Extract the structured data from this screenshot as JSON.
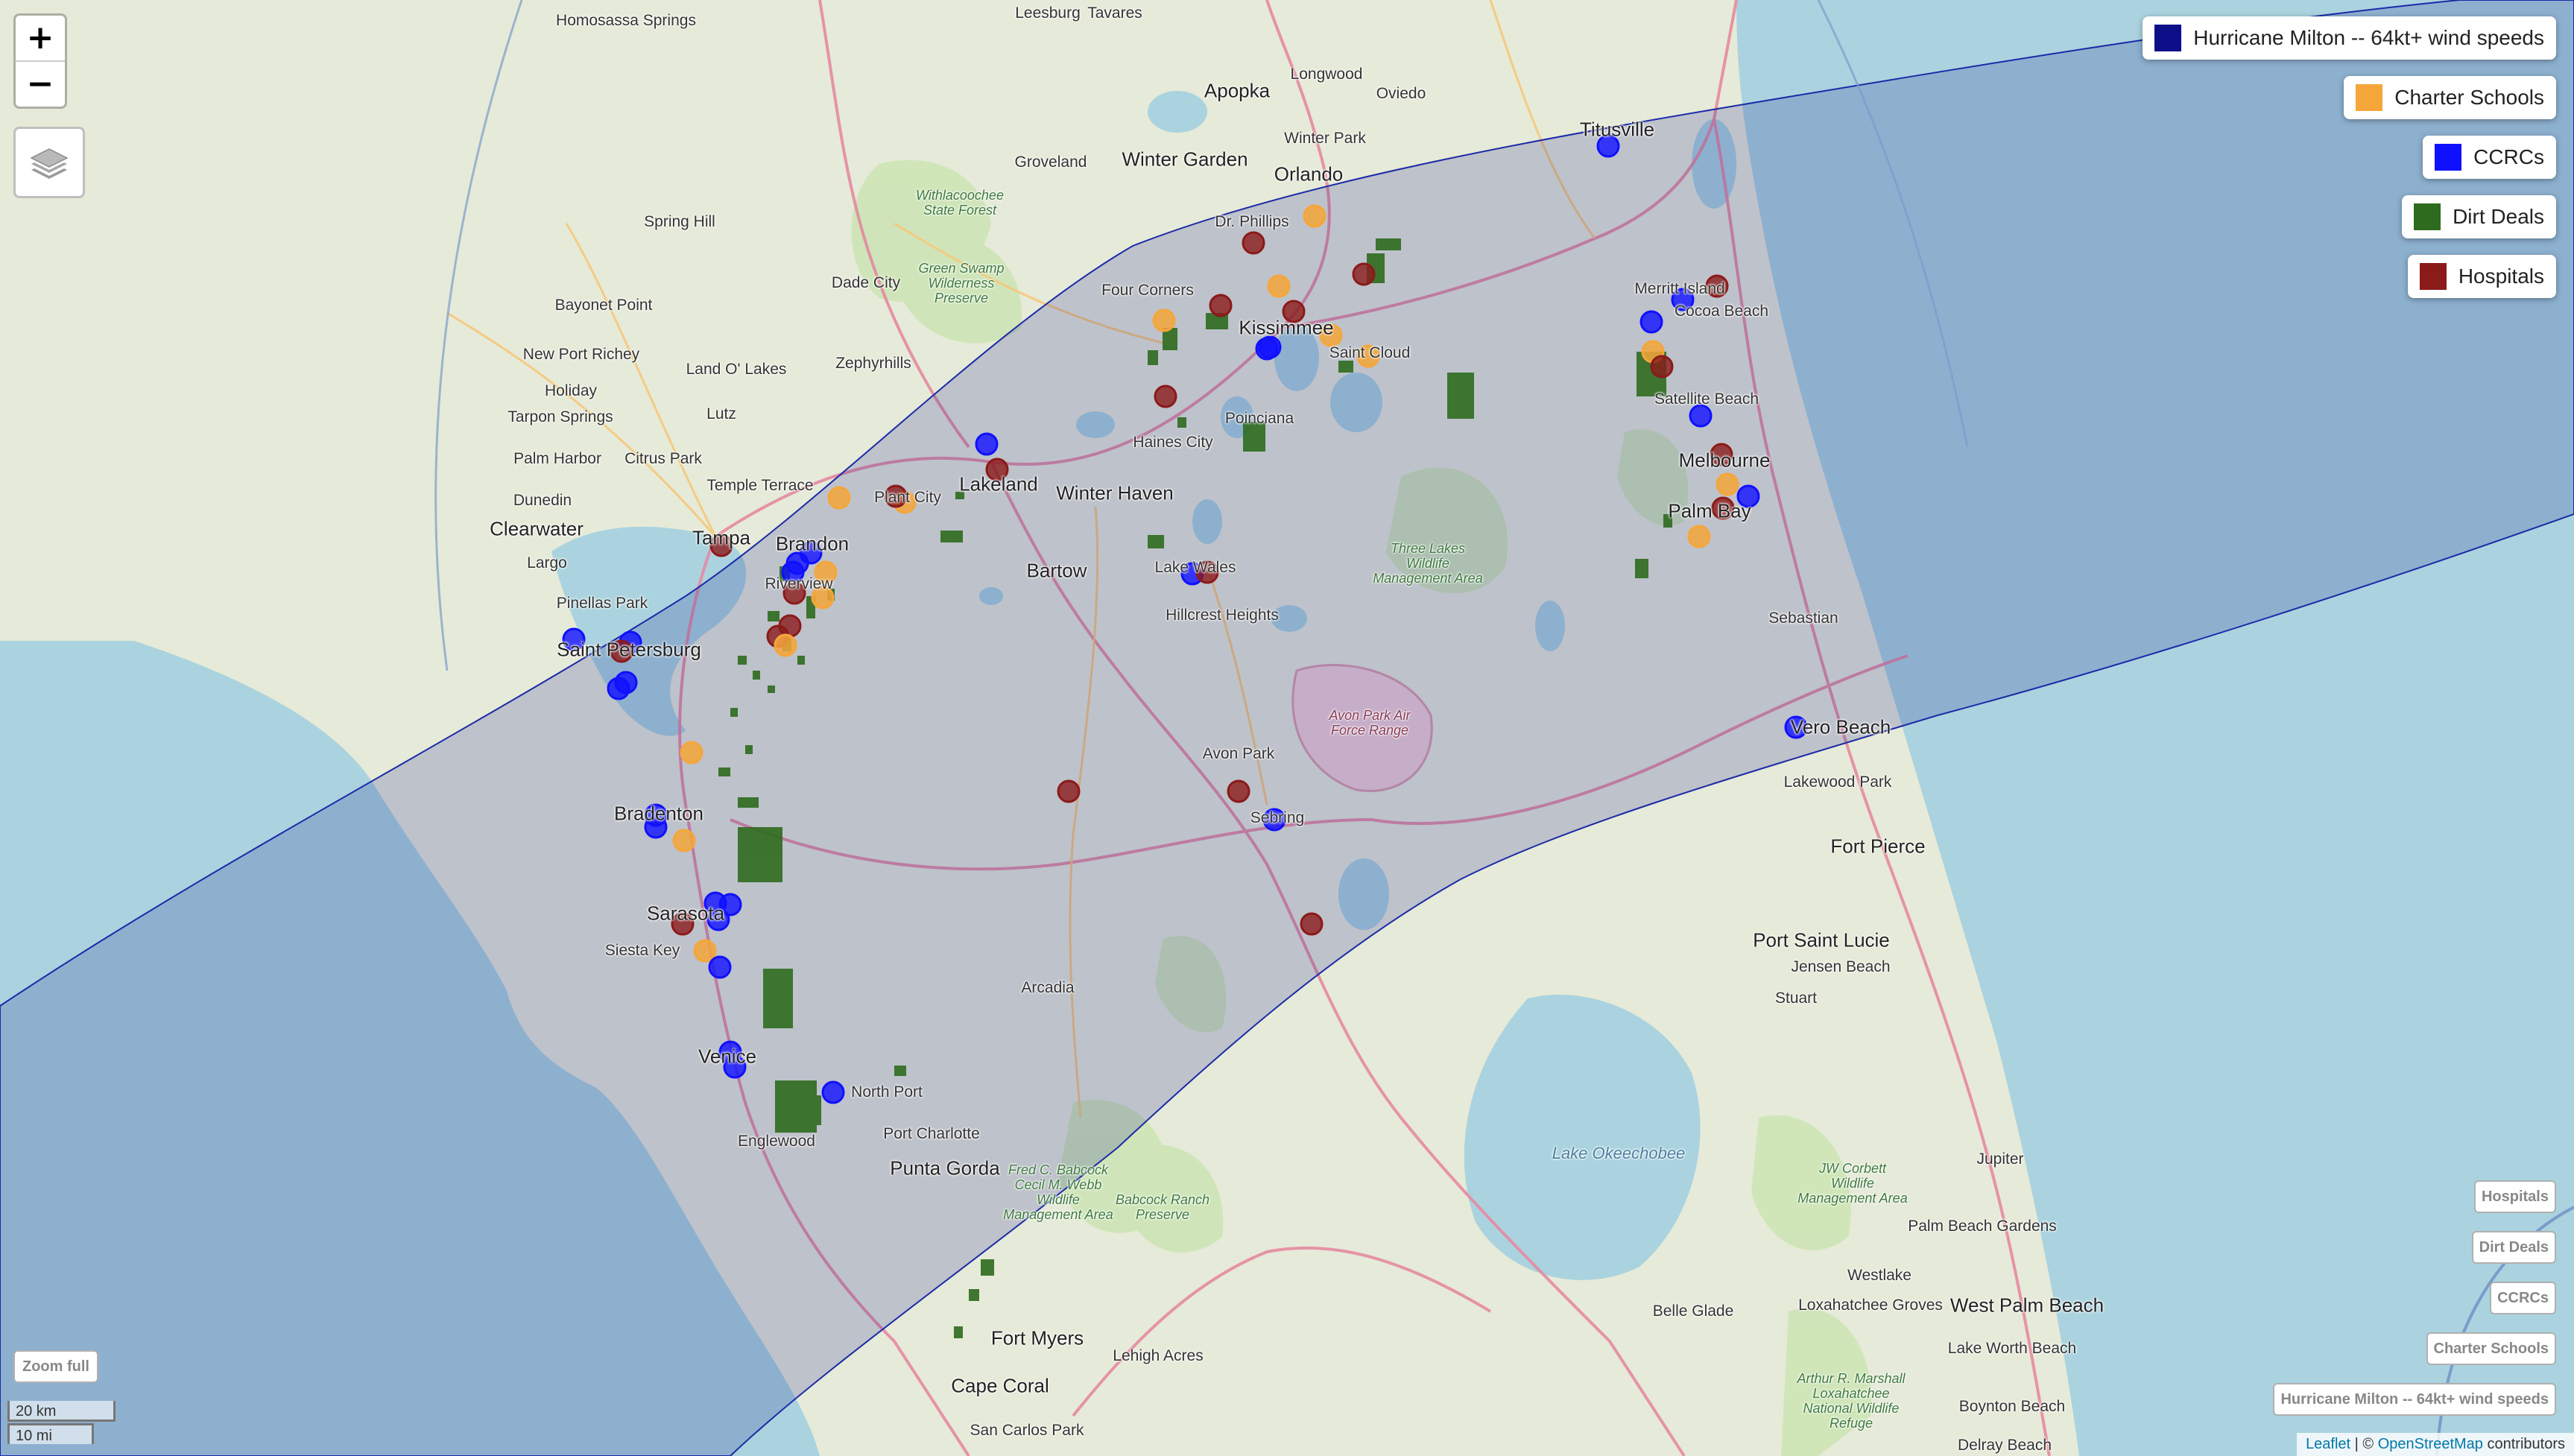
{
  "map": {
    "zoom_in_label": "+",
    "zoom_out_label": "−",
    "layers_icon": "layers-icon",
    "zoom_full_label": "Zoom full",
    "scale_km": "20 km",
    "scale_mi": "10 mi",
    "attribution": {
      "leaflet": "Leaflet",
      "separator": " | © ",
      "osm": "OpenStreetMap",
      "suffix": " contributors"
    }
  },
  "legend": [
    {
      "label": "Hurricane Milton -- 64kt+ wind speeds",
      "color": "#0d0f8a"
    },
    {
      "label": "Charter Schools",
      "color": "#f5a63a"
    },
    {
      "label": "CCRCs",
      "color": "#1010ff"
    },
    {
      "label": "Dirt Deals",
      "color": "#2e6b1f"
    },
    {
      "label": "Hospitals",
      "color": "#8b1a1a"
    }
  ],
  "layer_toggles": [
    "Hospitals",
    "Dirt Deals",
    "CCRCs",
    "Charter Schools",
    "Hurricane Milton -- 64kt+ wind speeds"
  ],
  "place_labels": [
    {
      "text": "Homosassa Springs",
      "cls": "city"
    },
    {
      "text": "Leesburg",
      "cls": "city"
    },
    {
      "text": "Tavares",
      "cls": "city"
    },
    {
      "text": "Apopka",
      "cls": "big"
    },
    {
      "text": "Longwood",
      "cls": "city"
    },
    {
      "text": "Oviedo",
      "cls": "city"
    },
    {
      "text": "Titusville",
      "cls": "big"
    },
    {
      "text": "Groveland",
      "cls": "city"
    },
    {
      "text": "Winter Garden",
      "cls": "big"
    },
    {
      "text": "Winter Park",
      "cls": "city"
    },
    {
      "text": "Orlando",
      "cls": "big"
    },
    {
      "text": "Spring Hill",
      "cls": "city"
    },
    {
      "text": "Dr. Phillips",
      "cls": "city"
    },
    {
      "text": "Dade City",
      "cls": "city"
    },
    {
      "text": "Four Corners",
      "cls": "city"
    },
    {
      "text": "Kissimmee",
      "cls": "big"
    },
    {
      "text": "Merritt Island",
      "cls": "city"
    },
    {
      "text": "Cocoa Beach",
      "cls": "city"
    },
    {
      "text": "Bayonet Point",
      "cls": "city"
    },
    {
      "text": "Zephyrhills",
      "cls": "city"
    },
    {
      "text": "New Port Richey",
      "cls": "city"
    },
    {
      "text": "Holiday",
      "cls": "city"
    },
    {
      "text": "Land O' Lakes",
      "cls": "city"
    },
    {
      "text": "Saint Cloud",
      "cls": "city"
    },
    {
      "text": "Satellite Beach",
      "cls": "city"
    },
    {
      "text": "Tarpon Springs",
      "cls": "city"
    },
    {
      "text": "Lutz",
      "cls": "city"
    },
    {
      "text": "Poinciana",
      "cls": "city"
    },
    {
      "text": "Palm Harbor",
      "cls": "city"
    },
    {
      "text": "Citrus Park",
      "cls": "city"
    },
    {
      "text": "Haines City",
      "cls": "city"
    },
    {
      "text": "Melbourne",
      "cls": "big"
    },
    {
      "text": "Dunedin",
      "cls": "city"
    },
    {
      "text": "Temple Terrace",
      "cls": "city"
    },
    {
      "text": "Plant City",
      "cls": "city"
    },
    {
      "text": "Lakeland",
      "cls": "big"
    },
    {
      "text": "Winter Haven",
      "cls": "big"
    },
    {
      "text": "Palm Bay",
      "cls": "big"
    },
    {
      "text": "Clearwater",
      "cls": "big"
    },
    {
      "text": "Tampa",
      "cls": "big"
    },
    {
      "text": "Brandon",
      "cls": "big"
    },
    {
      "text": "Largo",
      "cls": "city"
    },
    {
      "text": "Riverview",
      "cls": "city"
    },
    {
      "text": "Bartow",
      "cls": "big"
    },
    {
      "text": "Lake Wales",
      "cls": "city"
    },
    {
      "text": "Pinellas Park",
      "cls": "city"
    },
    {
      "text": "Sebastian",
      "cls": "city"
    },
    {
      "text": "Saint Petersburg",
      "cls": "big"
    },
    {
      "text": "Hillcrest Heights",
      "cls": "city"
    },
    {
      "text": "Vero Beach",
      "cls": "big"
    },
    {
      "text": "Lakewood Park",
      "cls": "city"
    },
    {
      "text": "Avon Park",
      "cls": "city"
    },
    {
      "text": "Sebring",
      "cls": "city"
    },
    {
      "text": "Fort Pierce",
      "cls": "big"
    },
    {
      "text": "Bradenton",
      "cls": "big"
    },
    {
      "text": "Sarasota",
      "cls": "big"
    },
    {
      "text": "Siesta Key",
      "cls": "city"
    },
    {
      "text": "Port Saint Lucie",
      "cls": "big"
    },
    {
      "text": "Jensen Beach",
      "cls": "city"
    },
    {
      "text": "Stuart",
      "cls": "city"
    },
    {
      "text": "Arcadia",
      "cls": "city"
    },
    {
      "text": "Venice",
      "cls": "big"
    },
    {
      "text": "North Port",
      "cls": "city"
    },
    {
      "text": "Port Charlotte",
      "cls": "city"
    },
    {
      "text": "Englewood",
      "cls": "city"
    },
    {
      "text": "Punta Gorda",
      "cls": "big"
    },
    {
      "text": "Jupiter",
      "cls": "city"
    },
    {
      "text": "Palm Beach Gardens",
      "cls": "city"
    },
    {
      "text": "Westlake",
      "cls": "city"
    },
    {
      "text": "Loxahatchee Groves",
      "cls": "city"
    },
    {
      "text": "West Palm Beach",
      "cls": "big"
    },
    {
      "text": "Belle Glade",
      "cls": "city"
    },
    {
      "text": "Fort Myers",
      "cls": "big"
    },
    {
      "text": "Lehigh Acres",
      "cls": "city"
    },
    {
      "text": "Cape Coral",
      "cls": "big"
    },
    {
      "text": "Lake Worth Beach",
      "cls": "city"
    },
    {
      "text": "Boynton Beach",
      "cls": "city"
    },
    {
      "text": "San Carlos Park",
      "cls": "city"
    },
    {
      "text": "Delray Beach",
      "cls": "city"
    },
    {
      "text": "Withlacoochee State Forest",
      "cls": "park"
    },
    {
      "text": "Green Swamp Wilderness Preserve",
      "cls": "park"
    },
    {
      "text": "Three Lakes Wildlife Management Area",
      "cls": "park"
    },
    {
      "text": "Avon Park Air Force Range",
      "cls": "airforce"
    },
    {
      "text": "Fred C. Babcock Cecil M. Webb Wildlife Management Area",
      "cls": "park"
    },
    {
      "text": "Babcock Ranch Preserve",
      "cls": "park"
    },
    {
      "text": "JW Corbett Wildlife Management Area",
      "cls": "park"
    },
    {
      "text": "Arthur R. Marshall Loxahatchee National Wildlife Refuge",
      "cls": "park"
    },
    {
      "text": "Lake Okeechobee",
      "cls": "lake"
    }
  ]
}
